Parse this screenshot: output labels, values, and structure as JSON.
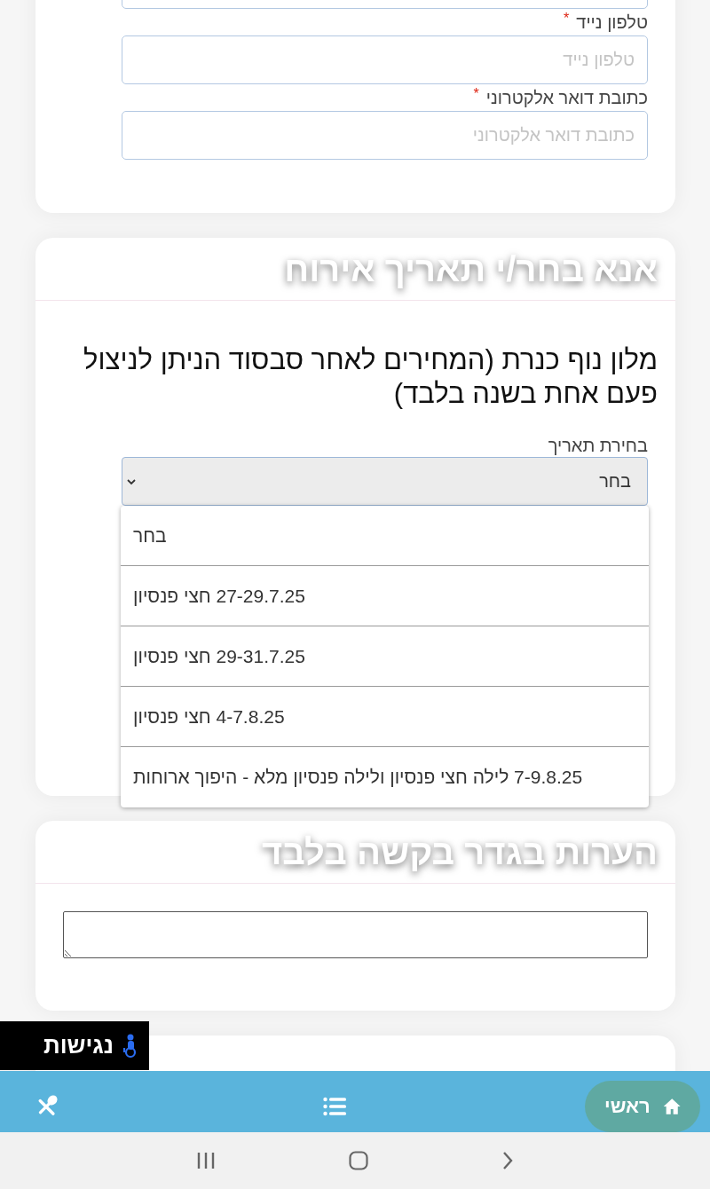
{
  "contact_fields": [
    {
      "label": "טלפון נייד",
      "required_mark": "*",
      "placeholder": "טלפון נייד"
    },
    {
      "label": "כתובת דואר אלקטרוני",
      "required_mark": "*",
      "placeholder": "כתובת דואר אלקטרוני"
    }
  ],
  "date_section": {
    "title": "אנא בחר/י תאריך אירוח",
    "note": "מלון נוף כנרת (המחירים לאחר סבסוד הניתן לניצול פעם אחת בשנה בלבד)",
    "select": {
      "label": "בחירת תאריך",
      "value": "בחר",
      "expanded": true,
      "options": [
        "בחר",
        "27-29.7.25 חצי פנסיון",
        "29-31.7.25 חצי פנסיון",
        "4-7.8.25 חצי פנסיון",
        "7-9.8.25 לילה חצי פנסיון ולילה פנסיון מלא - היפוך ארוחות"
      ]
    }
  },
  "notes_section": {
    "title": "הערות בגדר בקשה בלבד"
  },
  "accessibility_button": {
    "label": "נגישות"
  },
  "bottom_nav": [
    {
      "kind": "home",
      "label": "ראשי",
      "selected": true
    },
    {
      "kind": "menu",
      "selected": false
    },
    {
      "kind": "dining",
      "selected": false
    }
  ]
}
